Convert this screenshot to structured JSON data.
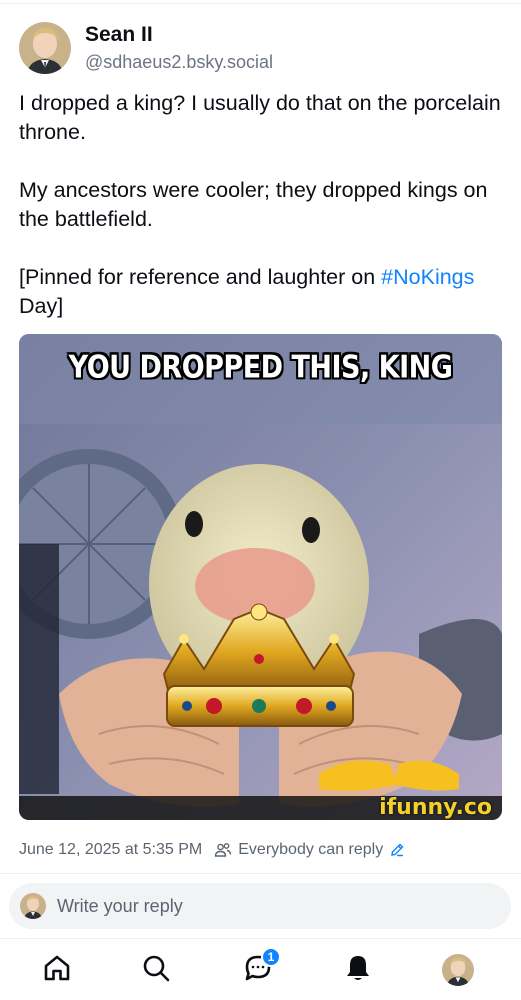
{
  "post": {
    "author": {
      "display_name": "Sean II",
      "handle": "@sdhaeus2.bsky.social"
    },
    "text": {
      "para1": "I dropped a king? I usually do that on the porcelain throne.",
      "para2": "My ancestors were cooler; they dropped kings on the battlefield.",
      "para3_before": "[Pinned for reference and laughter on ",
      "hashtag": "#NoKings",
      "para3_after": " Day]"
    },
    "image": {
      "caption": "YOU DROPPED THIS, KING",
      "watermark": "ifunny.co"
    },
    "timestamp": "June 12, 2025 at 5:35 PM",
    "reply_setting": "Everybody can reply"
  },
  "reply_bar": {
    "placeholder": "Write your reply"
  },
  "bottom_nav": {
    "items": [
      "home-icon",
      "search-icon",
      "chat-icon",
      "notifications-icon",
      "profile-avatar"
    ],
    "chat_badge": "1"
  },
  "colors": {
    "accent": "#1083fe",
    "text": "#0b0f14",
    "muted": "#5b6570"
  }
}
